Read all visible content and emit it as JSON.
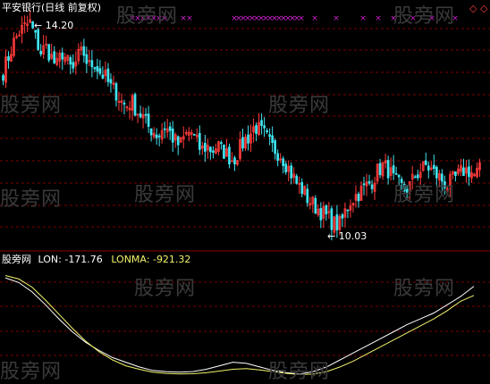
{
  "colors": {
    "background": "#000000",
    "grid": "#7a0000",
    "separator": "#8a0000",
    "up": "#ff3b3b",
    "down": "#3fe4f0",
    "lon_line": "#ffffff",
    "lonma_line": "#f2f26a",
    "markers": "#d020d0",
    "title_text": "#ffffff",
    "lonma_label": "#f2f26a"
  },
  "watermark": "股旁网",
  "upper_panel": {
    "title": "平安银行(日线 前复权)",
    "high_label": "14.20",
    "low_label": "10.03",
    "diamond_icons": [
      "◇",
      "◇"
    ]
  },
  "lower_panel": {
    "indicator_name": "股旁网",
    "lon_label": "LON:",
    "lon_value": "-171.76",
    "lonma_label": "LONMA:",
    "lonma_value": "-921.32"
  },
  "chart_data": [
    {
      "type": "candlestick",
      "title": "平安银行(日线 前复权)",
      "y_range": [
        9.8,
        14.4
      ],
      "annotated_high": 14.2,
      "annotated_low": 10.03,
      "close_path": [
        13.2,
        13.5,
        13.8,
        14.0,
        14.1,
        14.2,
        13.9,
        13.6,
        13.7,
        13.5,
        13.3,
        13.6,
        13.4,
        13.2,
        13.5,
        13.6,
        13.3,
        13.4,
        13.2,
        13.1,
        12.9,
        12.8,
        12.6,
        12.5,
        12.6,
        12.4,
        12.3,
        12.1,
        12.0,
        11.9,
        12.1,
        12.0,
        11.8,
        11.7,
        11.9,
        12.0,
        11.8,
        11.6,
        11.7,
        11.6,
        11.7,
        11.6,
        11.5,
        11.4,
        11.6,
        11.8,
        11.9,
        12.1,
        12.0,
        11.9,
        11.7,
        11.6,
        11.5,
        11.3,
        11.1,
        10.9,
        10.8,
        10.6,
        10.5,
        10.4,
        10.3,
        10.2,
        10.1,
        10.1,
        10.4,
        10.6,
        10.7,
        10.8,
        10.9,
        11.0,
        11.2,
        11.3,
        11.2,
        11.0,
        10.9,
        10.8,
        10.9,
        11.1,
        11.2,
        11.3,
        11.2,
        11.1,
        11.0,
        10.9,
        11.0,
        11.1,
        11.2,
        11.2,
        11.1,
        11.2
      ],
      "marker_rows": "top"
    },
    {
      "type": "line",
      "series": [
        {
          "name": "LON",
          "values": [
            -100,
            -140,
            -220,
            -330,
            -450,
            -560,
            -650,
            -720,
            -780,
            -820,
            -860,
            -890,
            -900,
            -905,
            -900,
            -880,
            -850,
            -820,
            -830,
            -860,
            -890,
            -910,
            -920,
            -900,
            -860,
            -800,
            -740,
            -680,
            -620,
            -560,
            -500,
            -450,
            -400,
            -330,
            -260,
            -172
          ]
        },
        {
          "name": "LONMA",
          "values": [
            -80,
            -110,
            -180,
            -290,
            -410,
            -530,
            -640,
            -730,
            -800,
            -850,
            -880,
            -905,
            -915,
            -920,
            -918,
            -910,
            -895,
            -880,
            -875,
            -885,
            -900,
            -915,
            -925,
            -921,
            -900,
            -860,
            -810,
            -750,
            -690,
            -630,
            -570,
            -510,
            -450,
            -380,
            -300,
            -250
          ]
        }
      ],
      "y_range": [
        -960,
        0
      ]
    }
  ]
}
